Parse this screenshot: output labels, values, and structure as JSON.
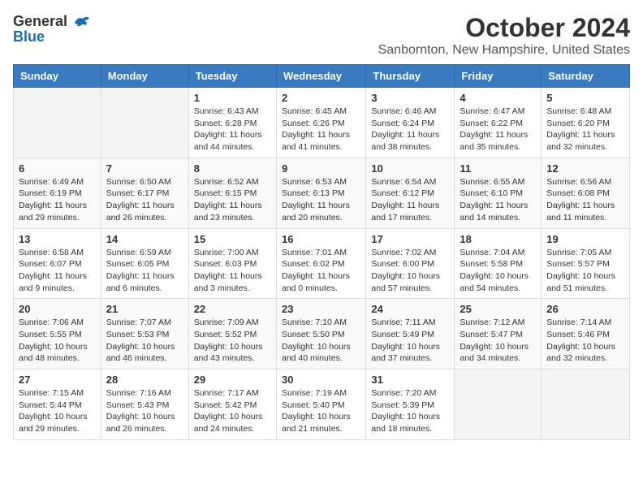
{
  "header": {
    "logo_general": "General",
    "logo_blue": "Blue",
    "month": "October 2024",
    "location": "Sanbornton, New Hampshire, United States"
  },
  "weekdays": [
    "Sunday",
    "Monday",
    "Tuesday",
    "Wednesday",
    "Thursday",
    "Friday",
    "Saturday"
  ],
  "weeks": [
    [
      {
        "day": "",
        "info": ""
      },
      {
        "day": "",
        "info": ""
      },
      {
        "day": "1",
        "info": "Sunrise: 6:43 AM\nSunset: 6:28 PM\nDaylight: 11 hours and 44 minutes."
      },
      {
        "day": "2",
        "info": "Sunrise: 6:45 AM\nSunset: 6:26 PM\nDaylight: 11 hours and 41 minutes."
      },
      {
        "day": "3",
        "info": "Sunrise: 6:46 AM\nSunset: 6:24 PM\nDaylight: 11 hours and 38 minutes."
      },
      {
        "day": "4",
        "info": "Sunrise: 6:47 AM\nSunset: 6:22 PM\nDaylight: 11 hours and 35 minutes."
      },
      {
        "day": "5",
        "info": "Sunrise: 6:48 AM\nSunset: 6:20 PM\nDaylight: 11 hours and 32 minutes."
      }
    ],
    [
      {
        "day": "6",
        "info": "Sunrise: 6:49 AM\nSunset: 6:19 PM\nDaylight: 11 hours and 29 minutes."
      },
      {
        "day": "7",
        "info": "Sunrise: 6:50 AM\nSunset: 6:17 PM\nDaylight: 11 hours and 26 minutes."
      },
      {
        "day": "8",
        "info": "Sunrise: 6:52 AM\nSunset: 6:15 PM\nDaylight: 11 hours and 23 minutes."
      },
      {
        "day": "9",
        "info": "Sunrise: 6:53 AM\nSunset: 6:13 PM\nDaylight: 11 hours and 20 minutes."
      },
      {
        "day": "10",
        "info": "Sunrise: 6:54 AM\nSunset: 6:12 PM\nDaylight: 11 hours and 17 minutes."
      },
      {
        "day": "11",
        "info": "Sunrise: 6:55 AM\nSunset: 6:10 PM\nDaylight: 11 hours and 14 minutes."
      },
      {
        "day": "12",
        "info": "Sunrise: 6:56 AM\nSunset: 6:08 PM\nDaylight: 11 hours and 11 minutes."
      }
    ],
    [
      {
        "day": "13",
        "info": "Sunrise: 6:58 AM\nSunset: 6:07 PM\nDaylight: 11 hours and 9 minutes."
      },
      {
        "day": "14",
        "info": "Sunrise: 6:59 AM\nSunset: 6:05 PM\nDaylight: 11 hours and 6 minutes."
      },
      {
        "day": "15",
        "info": "Sunrise: 7:00 AM\nSunset: 6:03 PM\nDaylight: 11 hours and 3 minutes."
      },
      {
        "day": "16",
        "info": "Sunrise: 7:01 AM\nSunset: 6:02 PM\nDaylight: 11 hours and 0 minutes."
      },
      {
        "day": "17",
        "info": "Sunrise: 7:02 AM\nSunset: 6:00 PM\nDaylight: 10 hours and 57 minutes."
      },
      {
        "day": "18",
        "info": "Sunrise: 7:04 AM\nSunset: 5:58 PM\nDaylight: 10 hours and 54 minutes."
      },
      {
        "day": "19",
        "info": "Sunrise: 7:05 AM\nSunset: 5:57 PM\nDaylight: 10 hours and 51 minutes."
      }
    ],
    [
      {
        "day": "20",
        "info": "Sunrise: 7:06 AM\nSunset: 5:55 PM\nDaylight: 10 hours and 48 minutes."
      },
      {
        "day": "21",
        "info": "Sunrise: 7:07 AM\nSunset: 5:53 PM\nDaylight: 10 hours and 46 minutes."
      },
      {
        "day": "22",
        "info": "Sunrise: 7:09 AM\nSunset: 5:52 PM\nDaylight: 10 hours and 43 minutes."
      },
      {
        "day": "23",
        "info": "Sunrise: 7:10 AM\nSunset: 5:50 PM\nDaylight: 10 hours and 40 minutes."
      },
      {
        "day": "24",
        "info": "Sunrise: 7:11 AM\nSunset: 5:49 PM\nDaylight: 10 hours and 37 minutes."
      },
      {
        "day": "25",
        "info": "Sunrise: 7:12 AM\nSunset: 5:47 PM\nDaylight: 10 hours and 34 minutes."
      },
      {
        "day": "26",
        "info": "Sunrise: 7:14 AM\nSunset: 5:46 PM\nDaylight: 10 hours and 32 minutes."
      }
    ],
    [
      {
        "day": "27",
        "info": "Sunrise: 7:15 AM\nSunset: 5:44 PM\nDaylight: 10 hours and 29 minutes."
      },
      {
        "day": "28",
        "info": "Sunrise: 7:16 AM\nSunset: 5:43 PM\nDaylight: 10 hours and 26 minutes."
      },
      {
        "day": "29",
        "info": "Sunrise: 7:17 AM\nSunset: 5:42 PM\nDaylight: 10 hours and 24 minutes."
      },
      {
        "day": "30",
        "info": "Sunrise: 7:19 AM\nSunset: 5:40 PM\nDaylight: 10 hours and 21 minutes."
      },
      {
        "day": "31",
        "info": "Sunrise: 7:20 AM\nSunset: 5:39 PM\nDaylight: 10 hours and 18 minutes."
      },
      {
        "day": "",
        "info": ""
      },
      {
        "day": "",
        "info": ""
      }
    ]
  ]
}
